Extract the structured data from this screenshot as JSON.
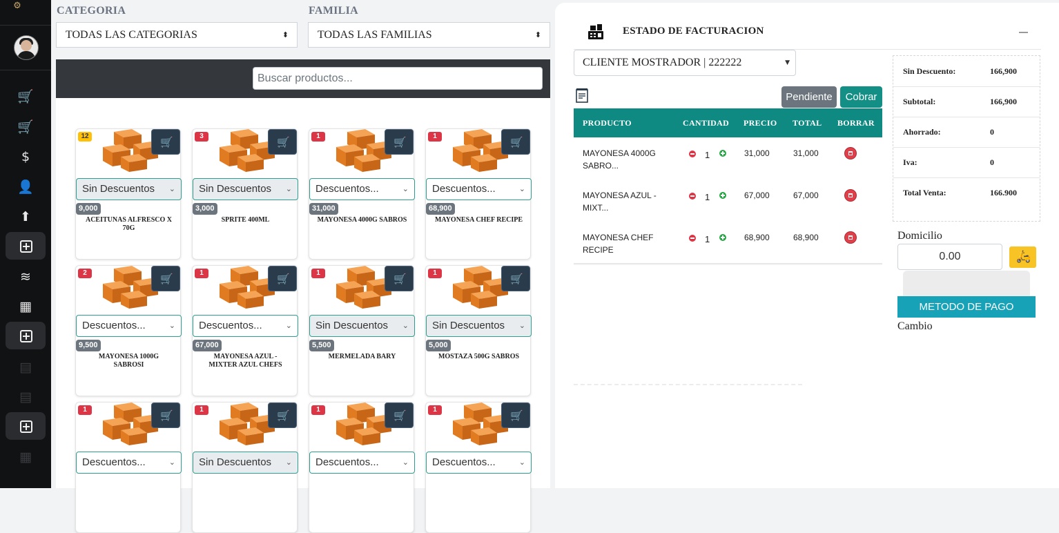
{
  "filters": {
    "categoria_label": "CATEGORIA",
    "categoria_value": "TODAS LAS CATEGORIAS",
    "familia_label": "FAMILIA",
    "familia_value": "TODAS LAS FAMILIAS"
  },
  "search": {
    "placeholder": "Buscar productos..."
  },
  "products": [
    {
      "badge": "12",
      "discount": "Sin Descuentos",
      "price": "9,000",
      "name": "ACEITUNAS ALFRESCO X 70G"
    },
    {
      "badge": "3",
      "discount": "Sin Descuentos",
      "price": "3,000",
      "name": "SPRITE 400ML"
    },
    {
      "badge": "1",
      "discount": "Descuentos...",
      "price": "31,000",
      "name": "MAYONESA 4000G SABROS"
    },
    {
      "badge": "1",
      "discount": "Descuentos...",
      "price": "68,900",
      "name": "MAYONESA CHEF RECIPE"
    },
    {
      "badge": "2",
      "discount": "Descuentos...",
      "price": "9,500",
      "name": "MAYONESA 1000G SABROSI"
    },
    {
      "badge": "1",
      "discount": "Descuentos...",
      "price": "67,000",
      "name": "MAYONESA AZUL - MIXTER AZUL CHEFS"
    },
    {
      "badge": "1",
      "discount": "Sin Descuentos",
      "price": "5,500",
      "name": "MERMELADA BARY"
    },
    {
      "badge": "1",
      "discount": "Sin Descuentos",
      "price": "5,000",
      "name": "MOSTAZA 500G SABROS"
    },
    {
      "badge": "1",
      "discount": "Descuentos...",
      "price": "",
      "name": ""
    },
    {
      "badge": "1",
      "discount": "Sin Descuentos",
      "price": "",
      "name": ""
    },
    {
      "badge": "1",
      "discount": "Descuentos...",
      "price": "",
      "name": ""
    },
    {
      "badge": "1",
      "discount": "Descuentos...",
      "price": "",
      "name": ""
    }
  ],
  "billing": {
    "title": "ESTADO DE FACTURACION",
    "client": "CLIENTE MOSTRADOR | 222222",
    "pending_label": "Pendiente",
    "charge_label": "Cobrar",
    "columns": [
      "PRODUCTO",
      "CANTIDAD",
      "PRECIO",
      "TOTAL",
      "BORRAR"
    ],
    "items": [
      {
        "product_line1": "MAYONESA 4000G",
        "product_line2": "SABRO...",
        "qty": "1",
        "price": "31,000",
        "total": "31,000"
      },
      {
        "product_line1": "MAYONESA AZUL -",
        "product_line2": "MIXT...",
        "qty": "1",
        "price": "67,000",
        "total": "67,000"
      },
      {
        "product_line1": "MAYONESA CHEF",
        "product_line2": "RECIPE",
        "qty": "1",
        "price": "68,900",
        "total": "68,900"
      }
    ]
  },
  "summary": {
    "rows": [
      {
        "label": "Sin Descuento:",
        "value": "166,900"
      },
      {
        "label": "Subtotal:",
        "value": "166,900"
      },
      {
        "label": "Ahorrado:",
        "value": "0"
      },
      {
        "label": "Iva:",
        "value": "0"
      },
      {
        "label": "Total Venta:",
        "value": "166.900"
      }
    ]
  },
  "delivery": {
    "label": "Domicilio",
    "value": "0.00"
  },
  "payment_method_label": "METODO DE PAGO",
  "change_label": "Cambio",
  "colors": {
    "teal": "#0f8a82",
    "dark_sidebar": "#111214",
    "badge_red": "#dc3545",
    "badge_yellow": "#ffc107"
  }
}
